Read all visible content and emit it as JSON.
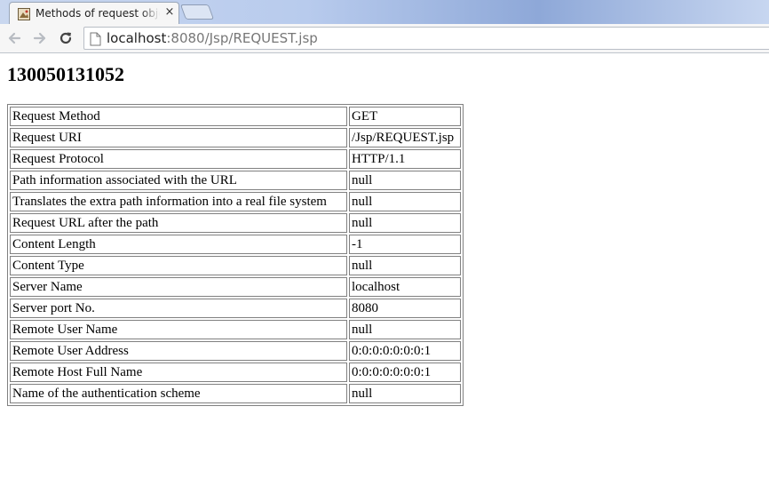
{
  "browser": {
    "tab_title": "Methods of request object",
    "tab_close": "×",
    "url_host": "localhost",
    "url_rest": ":8080/Jsp/REQUEST.jsp",
    "icons": {
      "back": "back-arrow-icon",
      "forward": "forward-arrow-icon",
      "reload": "reload-icon",
      "page": "page-icon",
      "favicon": "favicon-icon"
    }
  },
  "page": {
    "heading": "130050131052",
    "rows": [
      {
        "label": "Request Method",
        "value": "GET"
      },
      {
        "label": "Request URI",
        "value": "/Jsp/REQUEST.jsp"
      },
      {
        "label": "Request Protocol",
        "value": "HTTP/1.1"
      },
      {
        "label": "Path information associated with the URL",
        "value": "null"
      },
      {
        "label": "Translates the extra path information into a real file system",
        "value": "null"
      },
      {
        "label": "Request URL after the path",
        "value": "null"
      },
      {
        "label": "Content Length",
        "value": "-1"
      },
      {
        "label": "Content Type",
        "value": "null"
      },
      {
        "label": "Server Name",
        "value": "localhost"
      },
      {
        "label": "Server port No.",
        "value": "8080"
      },
      {
        "label": "Remote User Name",
        "value": "null"
      },
      {
        "label": "Remote User Address",
        "value": "0:0:0:0:0:0:0:1"
      },
      {
        "label": "Remote Host Full Name",
        "value": "0:0:0:0:0:0:0:1"
      },
      {
        "label": "Name of the authentication scheme",
        "value": "null"
      }
    ]
  }
}
